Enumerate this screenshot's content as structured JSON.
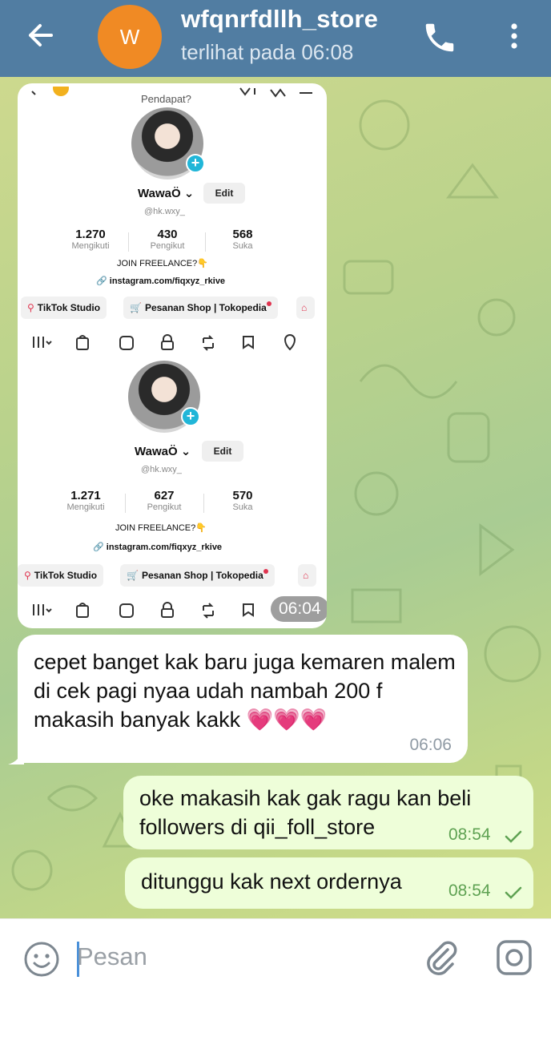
{
  "header": {
    "avatar_letter": "W",
    "title": "wfqnrfdllh_store",
    "status": "terlihat pada  06:08",
    "avatar_color": "#f08a24",
    "bar_color": "#517da2"
  },
  "image_message": {
    "time": "06:04",
    "screenshot_top": {
      "pendapat_label": "Pendapat?",
      "name": "WawaÖ",
      "edit_label": "Edit",
      "handle": "@hk.wxy_",
      "stats": [
        {
          "value": "1.270",
          "label": "Mengikuti"
        },
        {
          "value": "430",
          "label": "Pengikut"
        },
        {
          "value": "568",
          "label": "Suka"
        }
      ],
      "bio": "JOIN FREELANCE?👇",
      "link": "instagram.com/fiqxyz_rkive",
      "chips": [
        "TikTok Studio",
        "Pesanan Shop | Tokopedia"
      ]
    },
    "screenshot_bottom": {
      "name": "WawaÖ",
      "edit_label": "Edit",
      "handle": "@hk.wxy_",
      "stats": [
        {
          "value": "1.271",
          "label": "Mengikuti"
        },
        {
          "value": "627",
          "label": "Pengikut"
        },
        {
          "value": "570",
          "label": "Suka"
        }
      ],
      "bio": "JOIN FREELANCE?👇",
      "link": "instagram.com/fiqxyz_rkive",
      "chips": [
        "TikTok Studio",
        "Pesanan Shop | Tokopedia"
      ]
    }
  },
  "messages": {
    "incoming": {
      "text": "cepet banget kak baru juga kemaren malem di cek pagi nyaa udah nambah 200 f makasih banyak kakk 💗💗💗",
      "time": "06:06"
    },
    "outgoing_1": {
      "text": "oke makasih kak gak ragu kan beli followers di qii_foll_store",
      "time": "08:54"
    },
    "outgoing_2": {
      "text": "ditunggu kak next ordernya",
      "time": "08:54"
    }
  },
  "input": {
    "placeholder": "Pesan",
    "value": ""
  },
  "colors": {
    "outgoing_bubble": "#eefed9",
    "read_check": "#5fa253"
  }
}
